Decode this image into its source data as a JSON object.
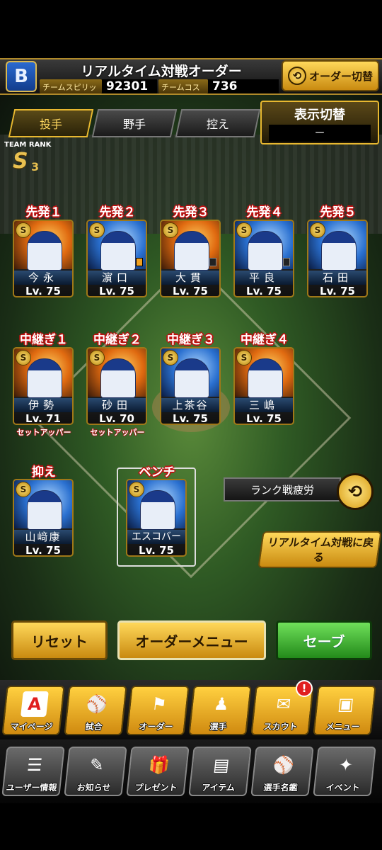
{
  "header": {
    "title": "リアルタイム対戦オーダー",
    "spirits_label": "チームスピリッツ",
    "spirits_value": "92301",
    "cost_label": "チームコスト",
    "cost_value": "736",
    "order_switch_label": "オーダー切替"
  },
  "tabs": [
    {
      "label": "投手",
      "active": true
    },
    {
      "label": "野手",
      "active": false
    },
    {
      "label": "控え",
      "active": false
    }
  ],
  "display_switch": {
    "label": "表示切替",
    "value": "－"
  },
  "team_rank": {
    "label": "TEAM RANK",
    "value": "S",
    "sub": "3"
  },
  "starters": [
    {
      "slot": "先発１",
      "name": "今永",
      "level": "Lv. 75"
    },
    {
      "slot": "先発２",
      "name": "濵口",
      "level": "Lv. 75"
    },
    {
      "slot": "先発３",
      "name": "大貫",
      "level": "Lv. 75"
    },
    {
      "slot": "先発４",
      "name": "平良",
      "level": "Lv. 75"
    },
    {
      "slot": "先発５",
      "name": "石田",
      "level": "Lv. 75"
    }
  ],
  "relievers": [
    {
      "slot": "中継ぎ１",
      "name": "伊勢",
      "level": "Lv. 71",
      "role": "セットアッパー"
    },
    {
      "slot": "中継ぎ２",
      "name": "砂田",
      "level": "Lv. 70",
      "role": "セットアッパー"
    },
    {
      "slot": "中継ぎ３",
      "name": "上茶谷",
      "level": "Lv. 75",
      "role": ""
    },
    {
      "slot": "中継ぎ４",
      "name": "三嶋",
      "level": "Lv. 75",
      "role": ""
    }
  ],
  "closer": {
    "slot": "抑え",
    "name": "山﨑康",
    "level": "Lv. 75"
  },
  "bench": {
    "slot": "ベンチ",
    "name": "エスコバー",
    "level": "Lv. 75"
  },
  "rank_fatigue_label": "ランク戦疲労",
  "back_button": "リアルタイム対戦に戻る",
  "buttons": {
    "reset": "リセット",
    "order_menu": "オーダーメニュー",
    "save": "セーブ"
  },
  "menu_row1": [
    {
      "label": "マイページ",
      "icon": "A"
    },
    {
      "label": "試合",
      "icon": "⚾"
    },
    {
      "label": "オーダー",
      "icon": "⚑"
    },
    {
      "label": "選手",
      "icon": "♟"
    },
    {
      "label": "スカウト",
      "icon": "✉"
    },
    {
      "label": "メニュー",
      "icon": "▣"
    }
  ],
  "menu_row2": [
    {
      "label": "ユーザー情報",
      "icon": "☰"
    },
    {
      "label": "お知らせ",
      "icon": "✎"
    },
    {
      "label": "プレゼント",
      "icon": "🎁"
    },
    {
      "label": "アイテム",
      "icon": "▤"
    },
    {
      "label": "選手名鑑",
      "icon": "⚾"
    },
    {
      "label": "イベント",
      "icon": "✦"
    }
  ],
  "scout_badge": "!"
}
